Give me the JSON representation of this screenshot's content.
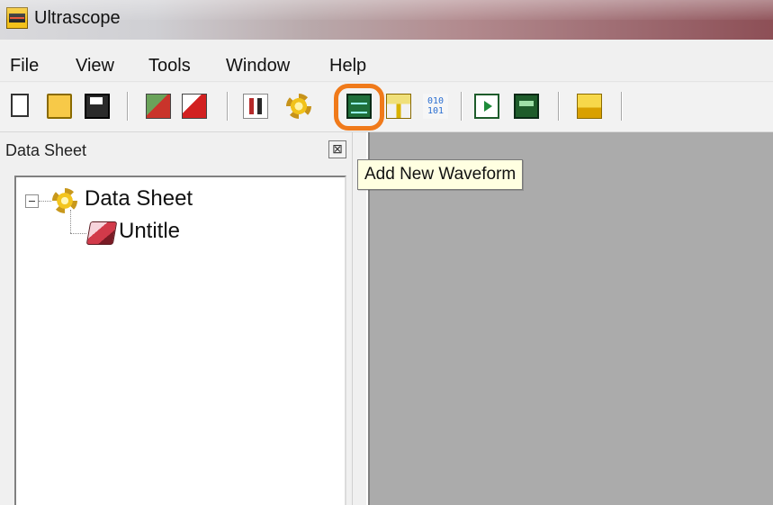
{
  "window": {
    "title": "Ultrascope"
  },
  "menu": [
    "File",
    "View",
    "Tools",
    "Window",
    "Help"
  ],
  "toolbar": {
    "buttons": [
      {
        "name": "new-file-icon"
      },
      {
        "name": "open-folder-icon"
      },
      {
        "name": "save-disk-icon"
      },
      {
        "name": "connect-icon"
      },
      {
        "name": "disconnect-icon"
      },
      {
        "name": "channel-tools-icon"
      },
      {
        "name": "settings-gear-icon"
      },
      {
        "name": "add-waveform-icon"
      },
      {
        "name": "ruler-icon"
      },
      {
        "name": "binary-data-icon",
        "text": "010\n101"
      },
      {
        "name": "play-capture-icon"
      },
      {
        "name": "waveform-export-icon"
      },
      {
        "name": "debug-icon"
      }
    ],
    "tooltip": "Add New Waveform",
    "highlight_color": "#f07a1a"
  },
  "data_sheet_pane": {
    "title": "Data Sheet",
    "close_glyph": "⊠",
    "tree": {
      "root": {
        "label": "Data Sheet",
        "icon": "gear-icon",
        "expanded": true
      },
      "children": [
        {
          "label": "Untitle",
          "icon": "document-stack-icon"
        }
      ]
    }
  },
  "workspace": {
    "background": "#ababab"
  }
}
